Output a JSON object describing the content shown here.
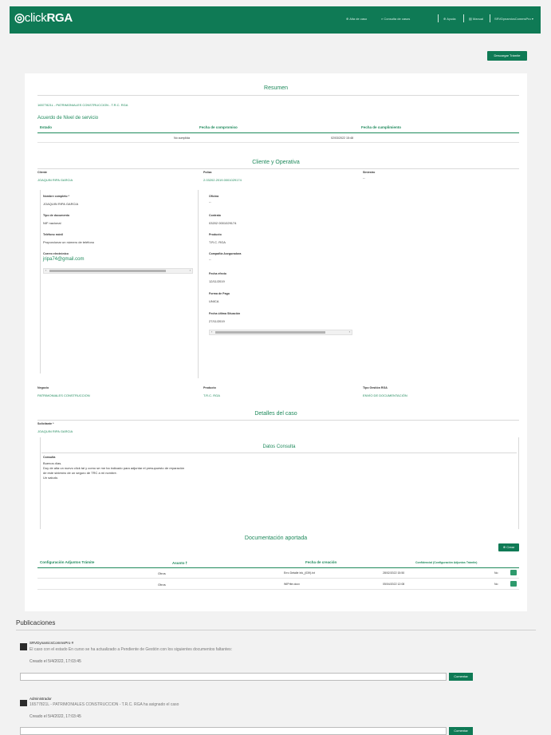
{
  "header": {
    "logo_click": "click",
    "logo_rga": "RGA",
    "nav": [
      "Alta de caso",
      "Consulta de casos",
      "Ayuda",
      "Manual",
      "SRVDynamicsCommsPro"
    ]
  },
  "download_button": "Descargar Trámite",
  "resumen": {
    "title": "Resumen",
    "case_title": "16577821L - PATRIMONIALES CONSTRUCCION - T.R.C. RGA",
    "ans_title": "Acuerdo de Nivel de servicio",
    "columns": [
      "Estado",
      "Fecha de compromiso",
      "Fecha de cumplimiento"
    ],
    "row": [
      "",
      "No cumplida",
      "02/03/2022 15:48"
    ]
  },
  "cliente": {
    "title": "Cliente y Operativa",
    "cliente_label": "Cliente",
    "cliente_value": "JOAQUIN RIPA GARCIA",
    "poliza_label": "Poliza",
    "poliza_value": "2.03202.2019.0001029174",
    "siniestro_label": "Siniestro",
    "siniestro_value": "--",
    "left_fields": [
      {
        "label": "Nombre completo *",
        "value": "JOAQUIN RIPA GARCIA"
      },
      {
        "label": "Tipo de documento",
        "value": "NIF nacional"
      },
      {
        "label": "Teléfono móvil",
        "value": "Proporcionar un número de teléfono"
      },
      {
        "label": "Correo electrónico",
        "value": "jripa74@gmail.com"
      }
    ],
    "right_fields": [
      {
        "label": "Oficina",
        "value": "--"
      },
      {
        "label": "Contrato",
        "value": "03202 0001029174"
      },
      {
        "label": "Producto",
        "value": "T.R.C. RGA"
      },
      {
        "label": "Compañía Aseguradora",
        "value": "--"
      },
      {
        "label": "Fecha efecto",
        "value": "12/11/2019"
      },
      {
        "label": "Forma de Pago",
        "value": "UNICA"
      },
      {
        "label": "Fecha última Situación",
        "value": "27/11/2019"
      }
    ],
    "negocio_label": "Negocio",
    "negocio_value": "PATRIMONIALES CONSTRUCCION",
    "producto_label": "Producto",
    "producto_value": "T.R.C. RGA",
    "tipo_label": "Tipo Gestión RGA",
    "tipo_value": "ENVÍO DE DOCUMENTACIÓN"
  },
  "detalles": {
    "title": "Detalles del caso",
    "solicitante_label": "Solicitante *",
    "solicitante_value": "JOAQUIN RIPA GARCIA",
    "datos_title": "Datos Consulta",
    "consulta_label": "Consulta",
    "consulta_lines": [
      "Buenos días.",
      "Doy de alta un nuevo click tal y como se me ha indicado para adjuntar el presupuesto de reparación",
      "de este siniestro de un seguro de TRC a mi nombre.",
      "Un saludo."
    ]
  },
  "documentacion": {
    "title": "Documentación aportada",
    "crear_button": "Crear",
    "columns": [
      "Configuración Adjuntos Trámite",
      "Asunto",
      "Fecha de creación",
      "Confidencial (Configuración Adjuntos Trámite)"
    ],
    "rows": [
      {
        "asunto": "Otros",
        "fecha_file": "Erro Detalle Ink_(039).txt",
        "fecha": "28/02/2022 15:50",
        "confidencial": "No"
      },
      {
        "asunto": "Otros",
        "fecha_file": "WIPrite.docx",
        "fecha": "05/04/2022 12:08",
        "confidencial": "No"
      }
    ]
  },
  "publicaciones": {
    "title": "Publicaciones",
    "comment_button": "Comentar",
    "posts": [
      {
        "author": "SRVDynamicsCommsPro #",
        "text": "El caso con el estado En curso se ha actualizado a Pendiente de Gestión con los siguientes documentos faltantes:",
        "created": "Creado el 5/4/2022, 17:03:45"
      },
      {
        "author": "Administrador",
        "text": "16577821L - PATRIMONIALES CONSTRUCCION - T.R.C. RGA ha asignado el caso",
        "created": "Creado el 5/4/2022, 17:03:45"
      }
    ]
  }
}
